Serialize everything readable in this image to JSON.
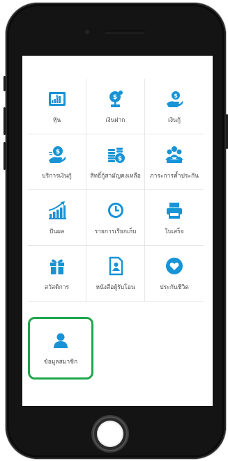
{
  "menu": {
    "items": [
      {
        "label": "หุ้น",
        "icon": "stock-chart-icon"
      },
      {
        "label": "เงินฝาก",
        "icon": "money-tree-icon"
      },
      {
        "label": "เงินกู้",
        "icon": "hand-money-icon"
      },
      {
        "label": "บริการเงินกู้",
        "icon": "loan-service-icon"
      },
      {
        "label": "สิทธิ์กู้สามัญคงเหลือ",
        "icon": "coins-stack-icon"
      },
      {
        "label": "ภาระการค้ำประกัน",
        "icon": "group-users-icon"
      },
      {
        "label": "ปันผล",
        "icon": "growth-chart-icon"
      },
      {
        "label": "รายการเรียกเก็บ",
        "icon": "clock-icon"
      },
      {
        "label": "ใบเสร็จ",
        "icon": "printer-icon"
      },
      {
        "label": "สวัสดิการ",
        "icon": "gift-icon"
      },
      {
        "label": "หนังสือผู้รับโอน",
        "icon": "document-person-icon"
      },
      {
        "label": "ประกันชีวิต",
        "icon": "heart-icon"
      },
      {
        "label": "ข้อมูลสมาชิก",
        "icon": "user-icon"
      }
    ]
  },
  "colors": {
    "accent": "#1793d6",
    "highlight": "#1fa54a"
  }
}
